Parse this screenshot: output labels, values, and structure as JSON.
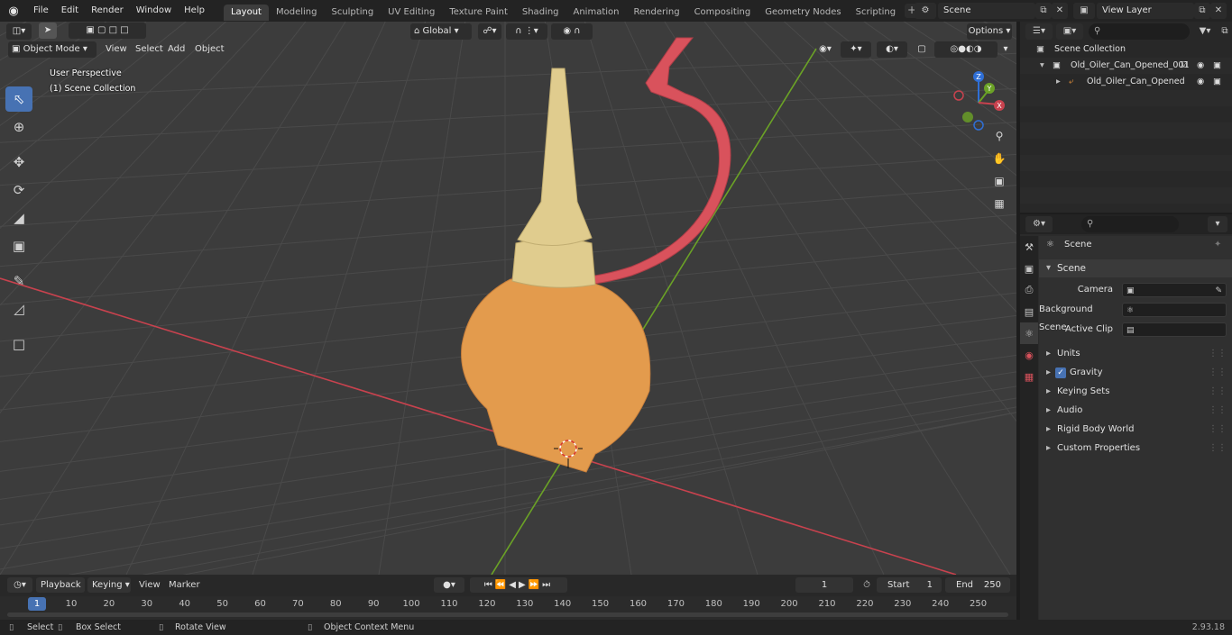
{
  "topbar": {
    "menus": [
      "File",
      "Edit",
      "Render",
      "Window",
      "Help"
    ],
    "workspaces": [
      "Layout",
      "Modeling",
      "Sculpting",
      "UV Editing",
      "Texture Paint",
      "Shading",
      "Animation",
      "Rendering",
      "Compositing",
      "Geometry Nodes",
      "Scripting"
    ],
    "active_workspace": "Layout",
    "scene_name": "Scene",
    "view_layer": "View Layer"
  },
  "viewport": {
    "mode": "Object Mode",
    "menus": [
      "View",
      "Select",
      "Add",
      "Object"
    ],
    "transform_orientation": "Global",
    "options_label": "Options",
    "perspective_label": "User Perspective",
    "collection_label": "(1) Scene Collection",
    "gizmo_axes": [
      "Z",
      "Y",
      "X"
    ]
  },
  "outliner": {
    "root": "Scene Collection",
    "collection": "Old_Oiler_Can_Opened_001",
    "object": "Old_Oiler_Can_Opened"
  },
  "properties": {
    "context_title": "Scene",
    "panel_title": "Scene",
    "fields": [
      {
        "label": "Camera",
        "value": ""
      },
      {
        "label": "Background Scene",
        "value": ""
      },
      {
        "label": "Active Clip",
        "value": ""
      }
    ],
    "subpanels": [
      "Units",
      "Gravity",
      "Keying Sets",
      "Audio",
      "Rigid Body World",
      "Custom Properties"
    ],
    "gravity_enabled": true
  },
  "timeline": {
    "menus": [
      "Playback",
      "Keying",
      "View",
      "Marker"
    ],
    "current_frame": "1",
    "start_label": "Start",
    "start_value": "1",
    "end_label": "End",
    "end_value": "250",
    "ruler_marks": [
      "1",
      "10",
      "20",
      "30",
      "40",
      "50",
      "60",
      "70",
      "80",
      "90",
      "100",
      "110",
      "120",
      "130",
      "140",
      "150",
      "160",
      "170",
      "180",
      "190",
      "200",
      "210",
      "220",
      "230",
      "240",
      "250"
    ]
  },
  "statusbar": {
    "select": "Select",
    "box_select": "Box Select",
    "rotate_view": "Rotate View",
    "context_menu": "Object Context Menu",
    "version": "2.93.18"
  },
  "colors": {
    "accent": "#4772b3",
    "x_axis": "#c8424e",
    "y_axis": "#6ba226",
    "oiler_body": "#e39b4d",
    "oiler_spout": "#e0cc8e",
    "oiler_strap": "#d9525c"
  }
}
